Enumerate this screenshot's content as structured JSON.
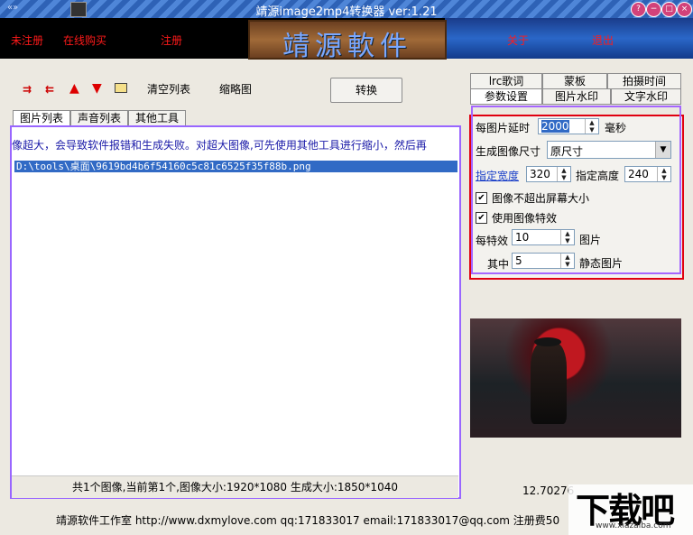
{
  "window": {
    "title": "靖源image2mp4转换器 ver:1.21",
    "title_buttons": [
      "?",
      "−",
      "□",
      "×"
    ]
  },
  "banner": {
    "unregistered": "未注册",
    "buy_online": "在线购买",
    "register": "注册",
    "logo_text": "靖源軟件",
    "about": "关于",
    "exit": "退出"
  },
  "toolbar": {
    "clear_list": "清空列表",
    "thumbnail": "缩略图",
    "convert": "转换"
  },
  "left_tabs": [
    "图片列表",
    "声音列表",
    "其他工具"
  ],
  "list": {
    "warning": "像超大，会导致软件报错和生成失败。对超大图像,可先使用其他工具进行缩小，然后再",
    "files": [
      "D:\\tools\\桌面\\9619bd4b6f54160c5c81c6525f35f88b.png"
    ],
    "status": "共1个图像,当前第1个,图像大小:1920*1080 生成大小:1850*1040"
  },
  "right_tabs_row1": [
    "lrc歌词",
    "蒙板",
    "拍摄时间"
  ],
  "right_tabs_row2": [
    "参数设置",
    "图片水印",
    "文字水印"
  ],
  "params": {
    "delay_label": "每图片延时",
    "delay_value": "2000",
    "delay_unit": "毫秒",
    "size_label": "生成图像尺寸",
    "size_value": "原尺寸",
    "width_label": "指定宽度",
    "width_value": "320",
    "height_label": "指定高度",
    "height_value": "240",
    "chk_screen": "图像不超出屏幕大小",
    "chk_effect": "使用图像特效",
    "per_effect_label": "每特效",
    "per_effect_value": "10",
    "per_effect_unit": "图片",
    "among_label": "其中",
    "among_value": "5",
    "among_unit": "静态图片"
  },
  "right_readout": "12.70276",
  "statusbar": "靖源软件工作室 http://www.dxmylove.com qq:171833017 email:171833017@qq.com 注册费50",
  "watermark": {
    "main": "下载吧",
    "sub": "www.xiazaiba.com"
  }
}
